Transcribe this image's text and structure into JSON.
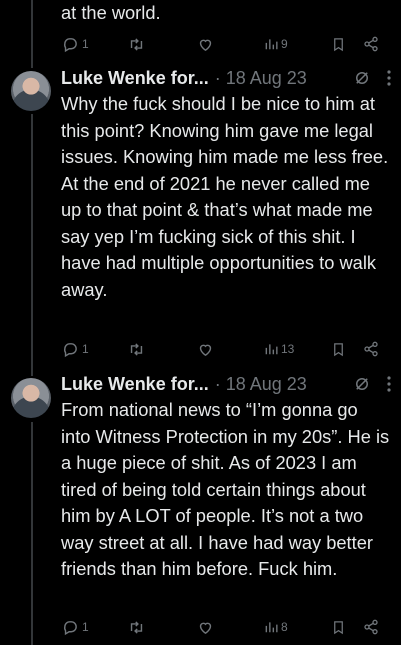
{
  "prev_tweet": {
    "text_tail": "at the world.",
    "replies": "1",
    "views": "9"
  },
  "tweets": [
    {
      "author": "Luke Wenke for...",
      "separator": "·",
      "date": "18 Aug 23",
      "text": "Why the fuck should I be nice to him at this point? Knowing him gave me legal issues. Knowing him made me less free. At the end of 2021 he never called me up to that point & that’s what made me say yep I’m fucking sick of this shit. I have had multiple opportunities to walk away.",
      "replies": "1",
      "views": "13"
    },
    {
      "author": "Luke Wenke for...",
      "separator": "·",
      "date": "18 Aug 23",
      "text": "From national news to “I’m gonna go into Witness Protection in my 20s”.  He is a huge piece of shit.  As of 2023 I am tired of being told certain things about him by A LOT of people.  It’s not a two way street at all.  I have had way better friends than him before.  Fuck him.",
      "replies": "1",
      "views": "8"
    }
  ],
  "colors": {
    "background": "#000000",
    "text": "#e7e9ea",
    "muted": "#71767b",
    "thread": "#333639"
  },
  "icons": [
    "reply-icon",
    "retweet-icon",
    "like-icon",
    "views-icon",
    "bookmark-icon",
    "share-icon",
    "grok-icon",
    "more-icon"
  ]
}
